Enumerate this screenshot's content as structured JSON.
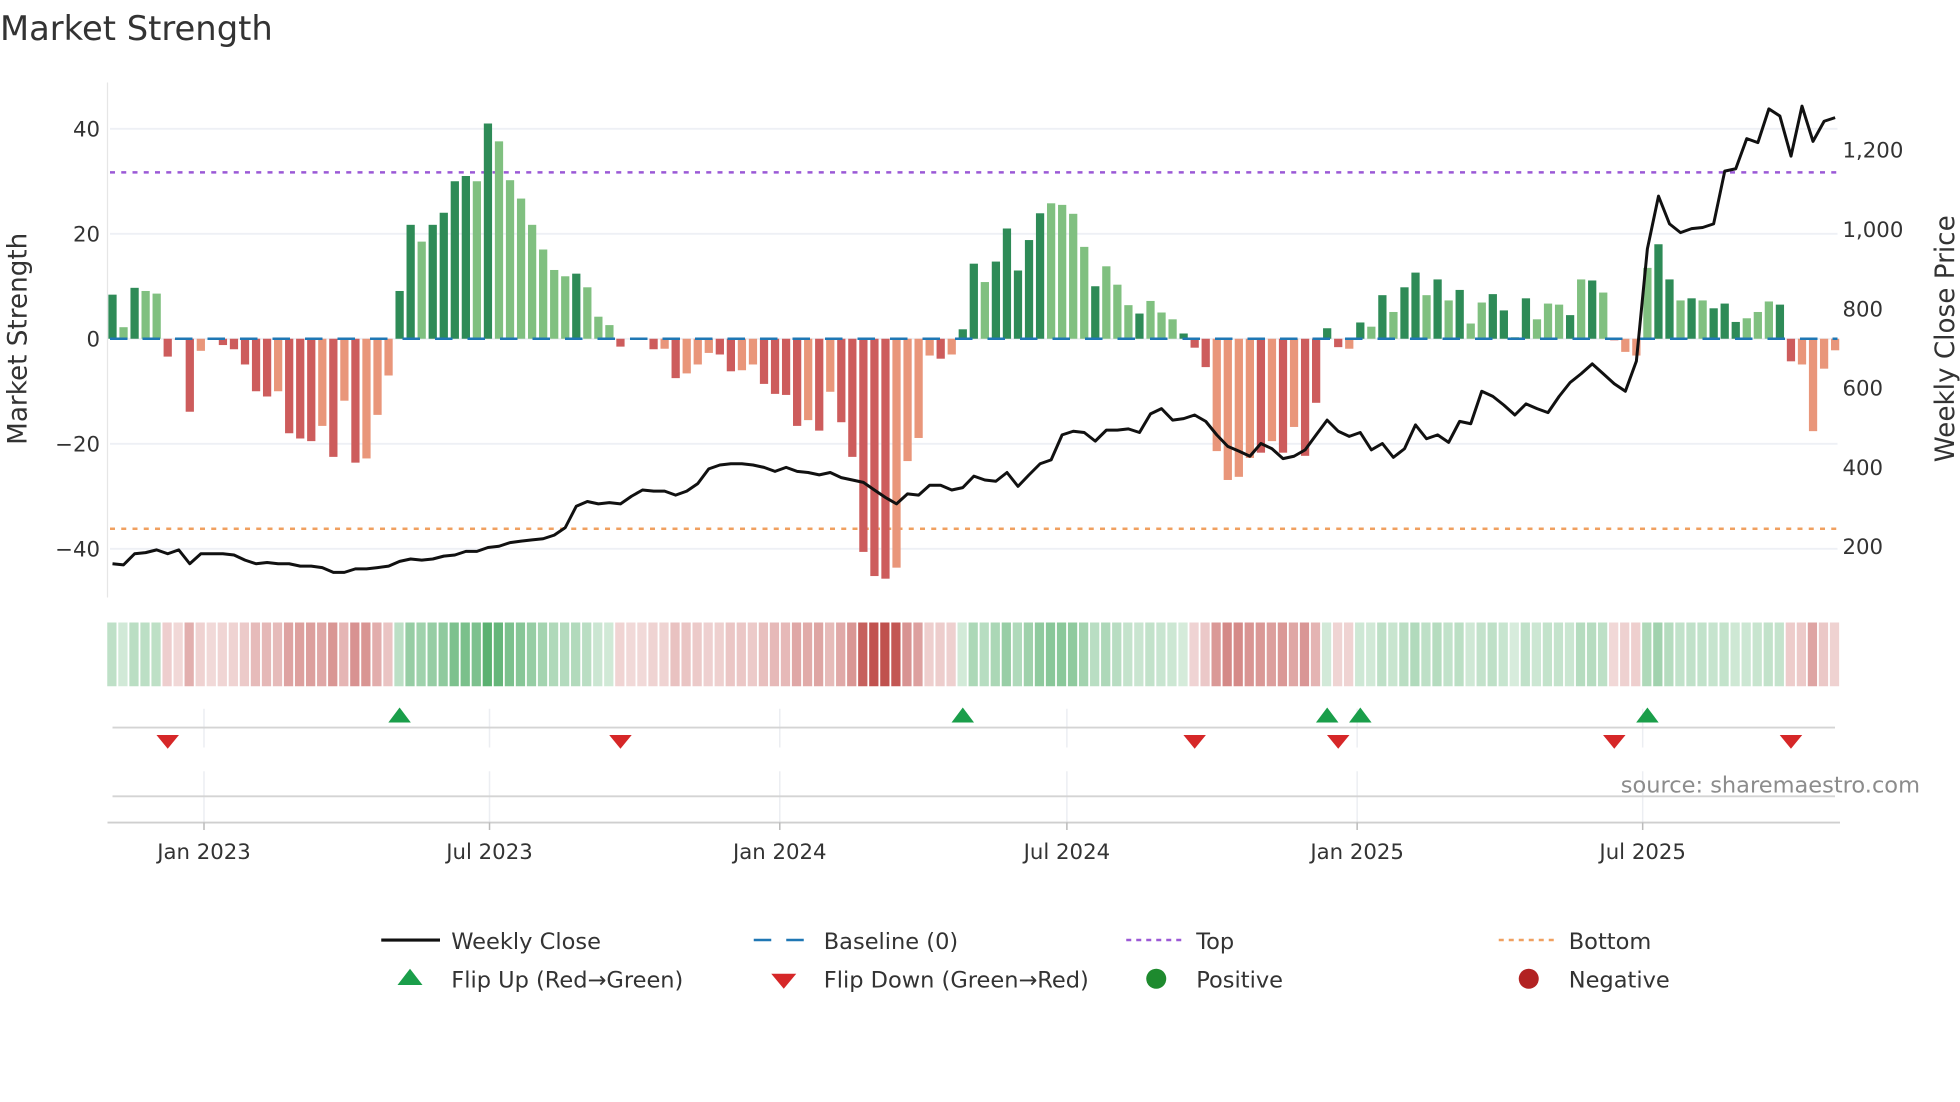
{
  "title": "Market Strength",
  "source": "source: sharemaestro.com",
  "colors": {
    "strong_green": "#2e8b57",
    "weak_green": "#80c080",
    "strong_red": "#cd5c5c",
    "weak_red": "#e9967a",
    "price": "#111111",
    "baseline": "#1f77b4",
    "top": "#9b59d6",
    "bottom": "#f0a060",
    "flip_up": "#1a9e4a",
    "flip_down": "#d62728",
    "positive": "#1e8a2e",
    "negative": "#b22222"
  },
  "legend": {
    "weekly_close": "Weekly Close",
    "baseline": "Baseline (0)",
    "top": "Top",
    "bottom": "Bottom",
    "flip_up": "Flip Up (Red→Green)",
    "flip_down": "Flip Down (Green→Red)",
    "positive": "Positive",
    "negative": "Negative"
  },
  "chart_data": {
    "type": "bar",
    "title": "Market Strength",
    "ylabel": "Market Strength",
    "y2label": "Weekly Close Price",
    "ylim": [
      -50,
      50
    ],
    "y2lim": [
      120,
      1380
    ],
    "y_ticks": [
      {
        "v": 40,
        "label": "40"
      },
      {
        "v": 20,
        "label": "20"
      },
      {
        "v": 0,
        "label": "0"
      },
      {
        "v": -20,
        "label": "−20"
      },
      {
        "v": -40,
        "label": "−40"
      }
    ],
    "y2_ticks": [
      {
        "v": 1200,
        "label": "1,200"
      },
      {
        "v": 1000,
        "label": "1,000"
      },
      {
        "v": 800,
        "label": "800"
      },
      {
        "v": 600,
        "label": "600"
      },
      {
        "v": 400,
        "label": "400"
      },
      {
        "v": 200,
        "label": "200"
      }
    ],
    "x_start": "2022-11-04",
    "x_step_days": 7,
    "x_ticks": [
      {
        "date": "2023-01-01",
        "label": "Jan 2023"
      },
      {
        "date": "2023-07-01",
        "label": "Jul 2023"
      },
      {
        "date": "2024-01-01",
        "label": "Jan 2024"
      },
      {
        "date": "2024-07-01",
        "label": "Jul 2024"
      },
      {
        "date": "2025-01-01",
        "label": "Jan 2025"
      },
      {
        "date": "2025-07-01",
        "label": "Jul 2025"
      }
    ],
    "top_level": 31.7,
    "bottom_level": -36.2,
    "baseline": 0,
    "strength": [
      8.4,
      2.2,
      9.7,
      9.1,
      8.6,
      -3.4,
      -0.2,
      -13.9,
      -2.3,
      0,
      -1.2,
      -2.0,
      -4.9,
      -10.0,
      -11.0,
      -10.0,
      -18.0,
      -19.0,
      -19.5,
      -16.6,
      -22.5,
      -11.8,
      -23.6,
      -22.8,
      -14.5,
      -7.0,
      9.1,
      21.7,
      18.5,
      21.7,
      24.0,
      30.0,
      31.0,
      30.0,
      41.0,
      37.6,
      30.2,
      26.7,
      21.7,
      17.0,
      13.1,
      11.9,
      12.4,
      9.8,
      4.2,
      2.6,
      -1.5,
      0,
      0,
      -2.0,
      -1.9,
      -7.5,
      -6.6,
      -4.9,
      -2.7,
      -3.0,
      -6.2,
      -6.0,
      -4.9,
      -8.6,
      -10.5,
      -10.7,
      -16.6,
      -15.5,
      -17.5,
      -10.1,
      -15.9,
      -22.5,
      -40.6,
      -45.2,
      -45.7,
      -43.6,
      -23.3,
      -18.9,
      -3.2,
      -3.8,
      -3.0,
      1.8,
      14.3,
      10.8,
      14.7,
      21.0,
      13.0,
      18.8,
      23.9,
      25.8,
      25.5,
      23.8,
      17.5,
      10.0,
      13.8,
      10.3,
      6.4,
      4.8,
      7.2,
      5.0,
      3.7,
      1.0,
      -1.7,
      -5.4,
      -21.4,
      -26.9,
      -26.3,
      -22.7,
      -21.7,
      -19.5,
      -21.7,
      -16.8,
      -22.3,
      -12.2,
      2.0,
      -1.6,
      -1.9,
      3.1,
      2.3,
      8.3,
      5.1,
      9.8,
      12.6,
      8.3,
      11.3,
      7.3,
      9.3,
      2.9,
      6.9,
      8.5,
      5.4,
      0.3,
      7.7,
      3.7,
      6.7,
      6.5,
      4.5,
      11.3,
      11.1,
      8.8,
      -0.3,
      -2.5,
      -3.2,
      13.5,
      18.0,
      11.3,
      7.3,
      7.7,
      7.3,
      5.8,
      6.7,
      3.2,
      3.9,
      5.1,
      7.1,
      6.5,
      -4.3,
      -4.9,
      -17.6,
      -5.7,
      -2.2
    ],
    "strength_shade": "SWSWWSWSW-SSSSSWSSSWSWSWWWSSWSSSSWSWWWWWWWSWWWS--SWSWWWSSWWSSSSWSWSSSSSWWWWSWSSWSSSSSWWWWSWWWSWWWSSSWWWWSWSWSSSSWSWSWSSWSWSWWSSWSWWWSWSWSWWWSSWSWSSSWWWSSWWWWSSWWSWSSSSWSSSWW",
    "weekly_close": [
      157,
      154,
      182,
      185,
      192,
      182,
      192,
      157,
      182,
      182,
      182,
      179,
      166,
      157,
      160,
      157,
      157,
      151,
      151,
      147,
      135,
      135,
      144,
      144,
      147,
      151,
      163,
      169,
      166,
      169,
      176,
      179,
      188,
      188,
      198,
      201,
      210,
      214,
      217,
      220,
      229,
      248,
      302,
      314,
      308,
      311,
      308,
      327,
      343,
      340,
      340,
      330,
      340,
      359,
      396,
      406,
      409,
      409,
      406,
      400,
      390,
      400,
      390,
      387,
      381,
      387,
      374,
      368,
      362,
      343,
      324,
      308,
      333,
      330,
      355,
      355,
      343,
      349,
      378,
      368,
      365,
      387,
      352,
      381,
      409,
      419,
      482,
      491,
      488,
      466,
      494,
      494,
      497,
      488,
      535,
      548,
      519,
      523,
      532,
      516,
      482,
      453,
      441,
      428,
      460,
      447,
      422,
      428,
      444,
      482,
      519,
      491,
      478,
      488,
      444,
      460,
      425,
      447,
      507,
      472,
      482,
      463,
      516,
      510,
      592,
      579,
      557,
      532,
      560,
      548,
      538,
      579,
      614,
      636,
      661,
      636,
      611,
      592,
      668,
      951,
      1084,
      1014,
      992,
      1002,
      1005,
      1014,
      1147,
      1153,
      1229,
      1219,
      1304,
      1286,
      1185,
      1311,
      1222,
      1273,
      1282
    ],
    "flip_up_weeks": [
      26,
      77,
      110,
      113,
      139
    ],
    "flip_down_weeks": [
      5,
      46,
      98,
      111,
      136,
      152
    ]
  }
}
